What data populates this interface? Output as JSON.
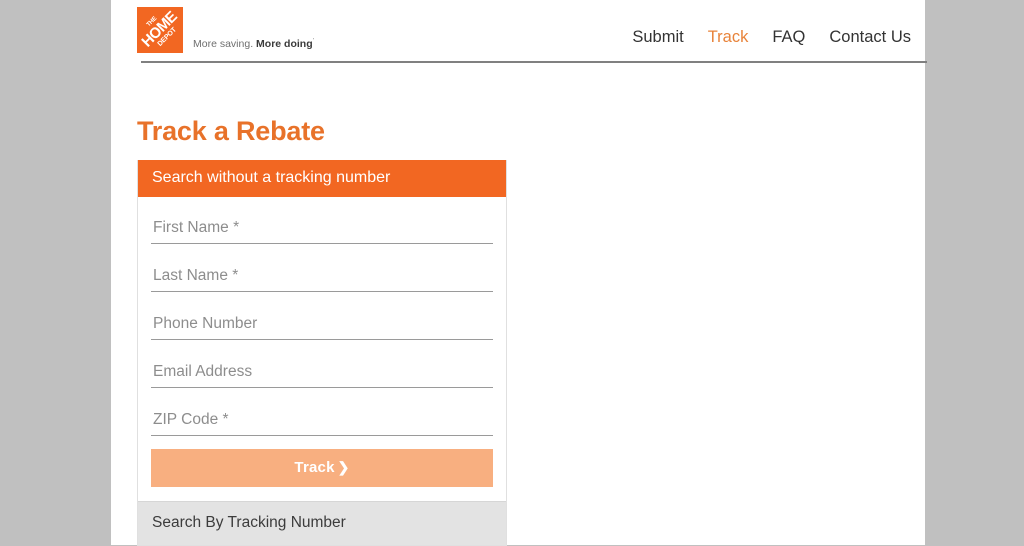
{
  "site": {
    "logo": {
      "name": "home-depot-logo",
      "line1": "THE",
      "line2": "HOME",
      "line3": "DEPOT",
      "brand_color": "#f26722"
    },
    "tagline_plain": "More saving.",
    "tagline_bold": "More doing",
    "tagline_mark": "’"
  },
  "nav": {
    "items": [
      {
        "label": "Submit",
        "active": false
      },
      {
        "label": "Track",
        "active": true
      },
      {
        "label": "FAQ",
        "active": false
      },
      {
        "label": "Contact Us",
        "active": false
      }
    ],
    "active_color": "#e8833a"
  },
  "page": {
    "title": "Track a Rebate",
    "title_color": "#e8722a",
    "background_color": "#c0c0c0"
  },
  "card": {
    "header_label": "Search without a tracking number",
    "header_color": "#f26722",
    "fields": [
      {
        "name": "first-name",
        "placeholder": "First Name *",
        "value": "",
        "required": true
      },
      {
        "name": "last-name",
        "placeholder": "Last Name *",
        "value": "",
        "required": true
      },
      {
        "name": "phone-number",
        "placeholder": "Phone Number",
        "value": "",
        "required": false
      },
      {
        "name": "email-address",
        "placeholder": "Email Address",
        "value": "",
        "required": false
      },
      {
        "name": "zip-code",
        "placeholder": "ZIP Code *",
        "value": "",
        "required": true
      }
    ],
    "submit": {
      "label": "Track",
      "chevron": "❯",
      "color": "#f8af80"
    },
    "accordion": {
      "label": "Search By Tracking Number",
      "color": "#e3e3e3"
    }
  }
}
